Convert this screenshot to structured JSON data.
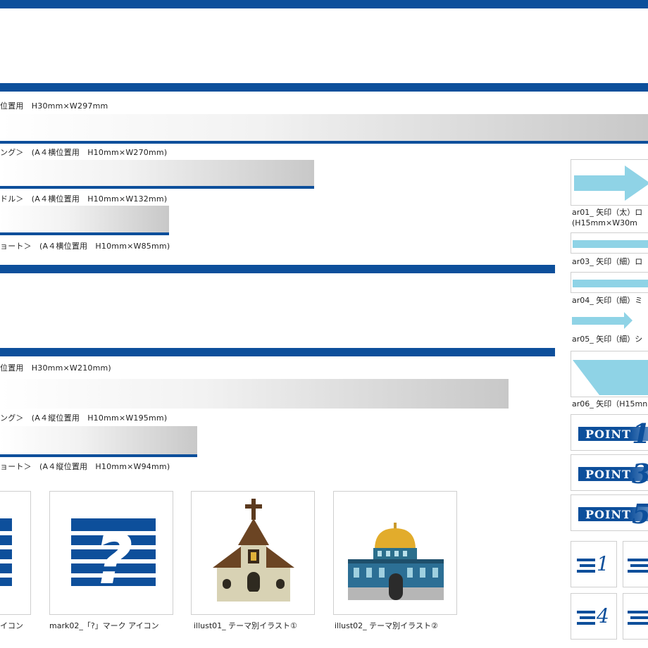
{
  "banners": {
    "a4_landscape_full_label": "位置用　H30mm×W297mm",
    "a4_landscape_long_label": "ング＞　(A４横位置用　H10mm×W270mm)",
    "a4_landscape_middle_label": "ドル＞　(A４横位置用　H10mm×W132mm)",
    "a4_landscape_short_label": "ョート＞　(A４横位置用　H10mm×W85mm)",
    "a4_portrait_full_label": "位置用　H30mm×W210mm)",
    "a4_portrait_long_label": "ング＞　(A４縦位置用　H10mm×W195mm)",
    "a4_portrait_short_label": "ョート＞　(A４縦位置用　H10mm×W94mm)"
  },
  "arrows": {
    "ar01_line1": "ar01_ 矢印（太）ロ",
    "ar01_line2": "(H15mm×W30m",
    "ar03": "ar03_ 矢印（細）ロ",
    "ar04": "ar04_ 矢印（細）ミ",
    "ar05": "ar05_ 矢印（細）シ",
    "ar06": "ar06_ 矢印（H15mn"
  },
  "points": {
    "word": "POINT",
    "p1": "1",
    "p3": "3",
    "p5": "5"
  },
  "small_icons": {
    "n1": "1",
    "n4": "4"
  },
  "thumbnails": {
    "mark01_caption": "イコン",
    "mark02_caption": "mark02_「?」マーク アイコン",
    "mark02_glyph": "?",
    "illust01_caption": "illust01_ テーマ別イラスト①",
    "illust02_caption": "illust02_ テーマ別イラスト②"
  },
  "colors": {
    "brand_blue": "#0d4f9b",
    "arrow_cyan": "#8fd3e6",
    "gradient_gray": "#c8c8c8"
  }
}
